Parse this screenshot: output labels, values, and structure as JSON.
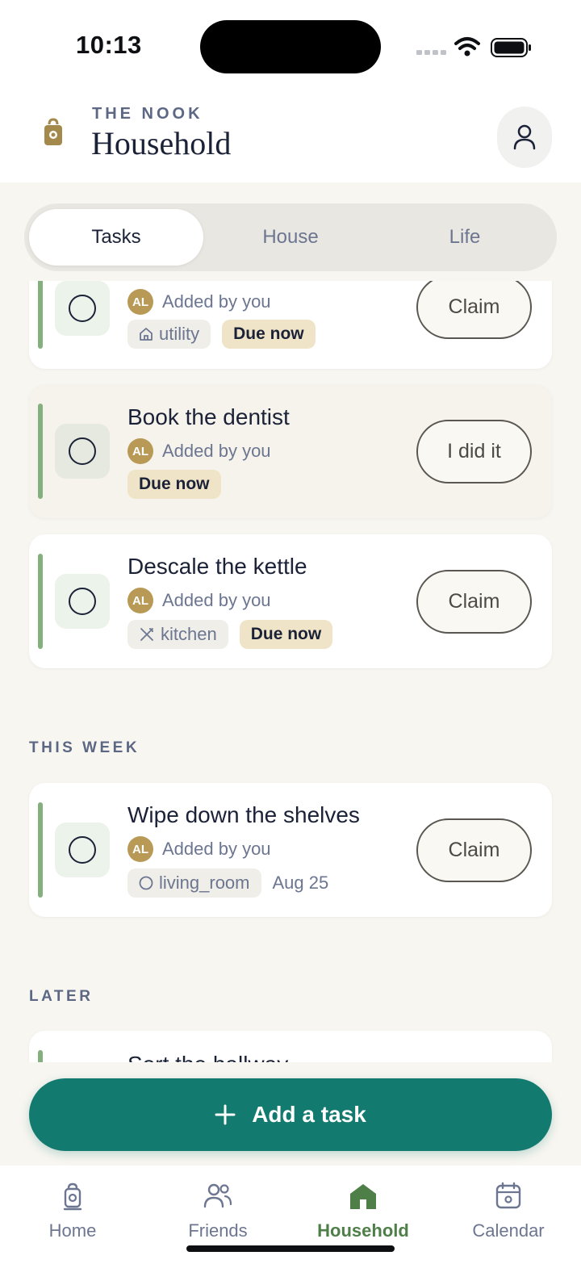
{
  "status_bar": {
    "time": "10:13"
  },
  "header": {
    "eyebrow": "THE NOOK",
    "title": "Household"
  },
  "segments": [
    {
      "label": "Tasks",
      "active": true
    },
    {
      "label": "House",
      "active": false
    },
    {
      "label": "Life",
      "active": false
    }
  ],
  "sections": {
    "this_week": "THIS WEEK",
    "later": "LATER"
  },
  "tasks": [
    {
      "title": "",
      "added_by": "Added by you",
      "avatar": "AL",
      "tag": "utility",
      "tag_icon": "house-icon",
      "due": "Due now",
      "action": "Claim"
    },
    {
      "title": "Book the dentist",
      "added_by": "Added by you",
      "avatar": "AL",
      "due": "Due now",
      "action": "I did it"
    },
    {
      "title": "Descale the kettle",
      "added_by": "Added by you",
      "avatar": "AL",
      "tag": "kitchen",
      "tag_icon": "utensils-icon",
      "due": "Due now",
      "action": "Claim"
    },
    {
      "title": "Wipe down the shelves",
      "added_by": "Added by you",
      "avatar": "AL",
      "tag": "living_room",
      "tag_icon": "circle-icon",
      "date": "Aug 25",
      "action": "Claim"
    },
    {
      "title": "Sort the hallway"
    }
  ],
  "add_button": {
    "label": "Add a task"
  },
  "tab_bar": [
    {
      "label": "Home",
      "icon": "lantern-icon",
      "active": false
    },
    {
      "label": "Friends",
      "icon": "people-icon",
      "active": false
    },
    {
      "label": "Household",
      "icon": "house-icon",
      "active": true
    },
    {
      "label": "Calendar",
      "icon": "calendar-icon",
      "active": false
    }
  ],
  "colors": {
    "accent": "#137a70",
    "active_tab": "#4f7f48",
    "due_badge": "#f0e4c8",
    "task_bar": "#84b07e",
    "avatar": "#b89a56"
  }
}
